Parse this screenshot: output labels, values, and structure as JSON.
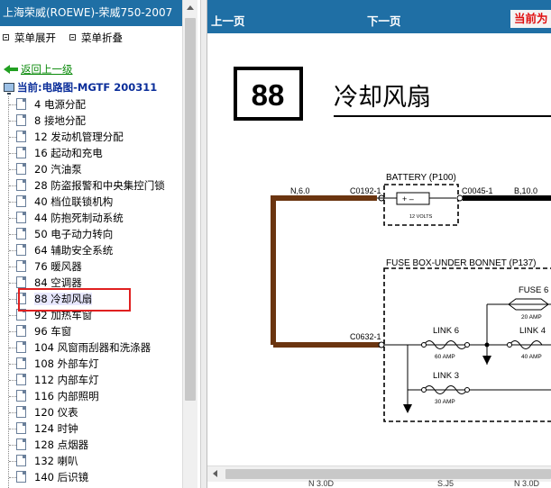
{
  "left_panel": {
    "title": "上海荣威(ROEWE)-荣威750-2007",
    "expand_label": "菜单展开",
    "collapse_label": "菜单折叠",
    "back_label": "返回上一级",
    "current_label": "当前:电路图-MGTF 200311",
    "items": [
      {
        "label": "4 电源分配"
      },
      {
        "label": "8 接地分配"
      },
      {
        "label": "12 发动机管理分配"
      },
      {
        "label": "16 起动和充电"
      },
      {
        "label": "20 汽油泵"
      },
      {
        "label": "28 防盗报警和中央集控门锁"
      },
      {
        "label": "40 档位联锁机构"
      },
      {
        "label": "44 防抱死制动系统"
      },
      {
        "label": "50 电子动力转向"
      },
      {
        "label": "64 辅助安全系统"
      },
      {
        "label": "76 暖风器"
      },
      {
        "label": "84 空调器"
      },
      {
        "label": "88 冷却风扇"
      },
      {
        "label": "92 加热车窗"
      },
      {
        "label": "96 车窗"
      },
      {
        "label": "104 风窗雨刮器和洗涤器"
      },
      {
        "label": "108 外部车灯"
      },
      {
        "label": "112 内部车灯"
      },
      {
        "label": "116 内部照明"
      },
      {
        "label": "120 仪表"
      },
      {
        "label": "124 时钟"
      },
      {
        "label": "128 点烟器"
      },
      {
        "label": "132 喇叭"
      },
      {
        "label": "140 后识镜"
      }
    ],
    "selected_index": 12
  },
  "right_panel": {
    "prev_label": "上一页",
    "next_label": "下一页",
    "current_label": "当前为"
  },
  "diagram": {
    "page_number": "88",
    "title": "冷却风扇",
    "wire_left": "N,6.0",
    "wire_right": "B,10.0",
    "conn_c0192": "C0192-1",
    "conn_c0045": "C0045-1",
    "conn_c0632": "C0632-1",
    "battery_label": "BATTERY (P100)",
    "battery_volts": "12 VOLTS",
    "fusebox_label": "FUSE BOX-UNDER BONNET (P137)",
    "fuse6_label": "FUSE 6",
    "fuse6_amp": "20 AMP",
    "link6_label": "LINK 6",
    "link6_amp": "60 AMP",
    "link4_label": "LINK 4",
    "link4_amp": "40 AMP",
    "link3_label": "LINK 3",
    "link3_amp": "30 AMP",
    "bottom_labels": [
      "N 3.0D",
      "S.J5",
      "N 3.0D"
    ],
    "colors": {
      "wire_brown": "#6b3510",
      "header_blue": "#1f6fa5"
    }
  }
}
